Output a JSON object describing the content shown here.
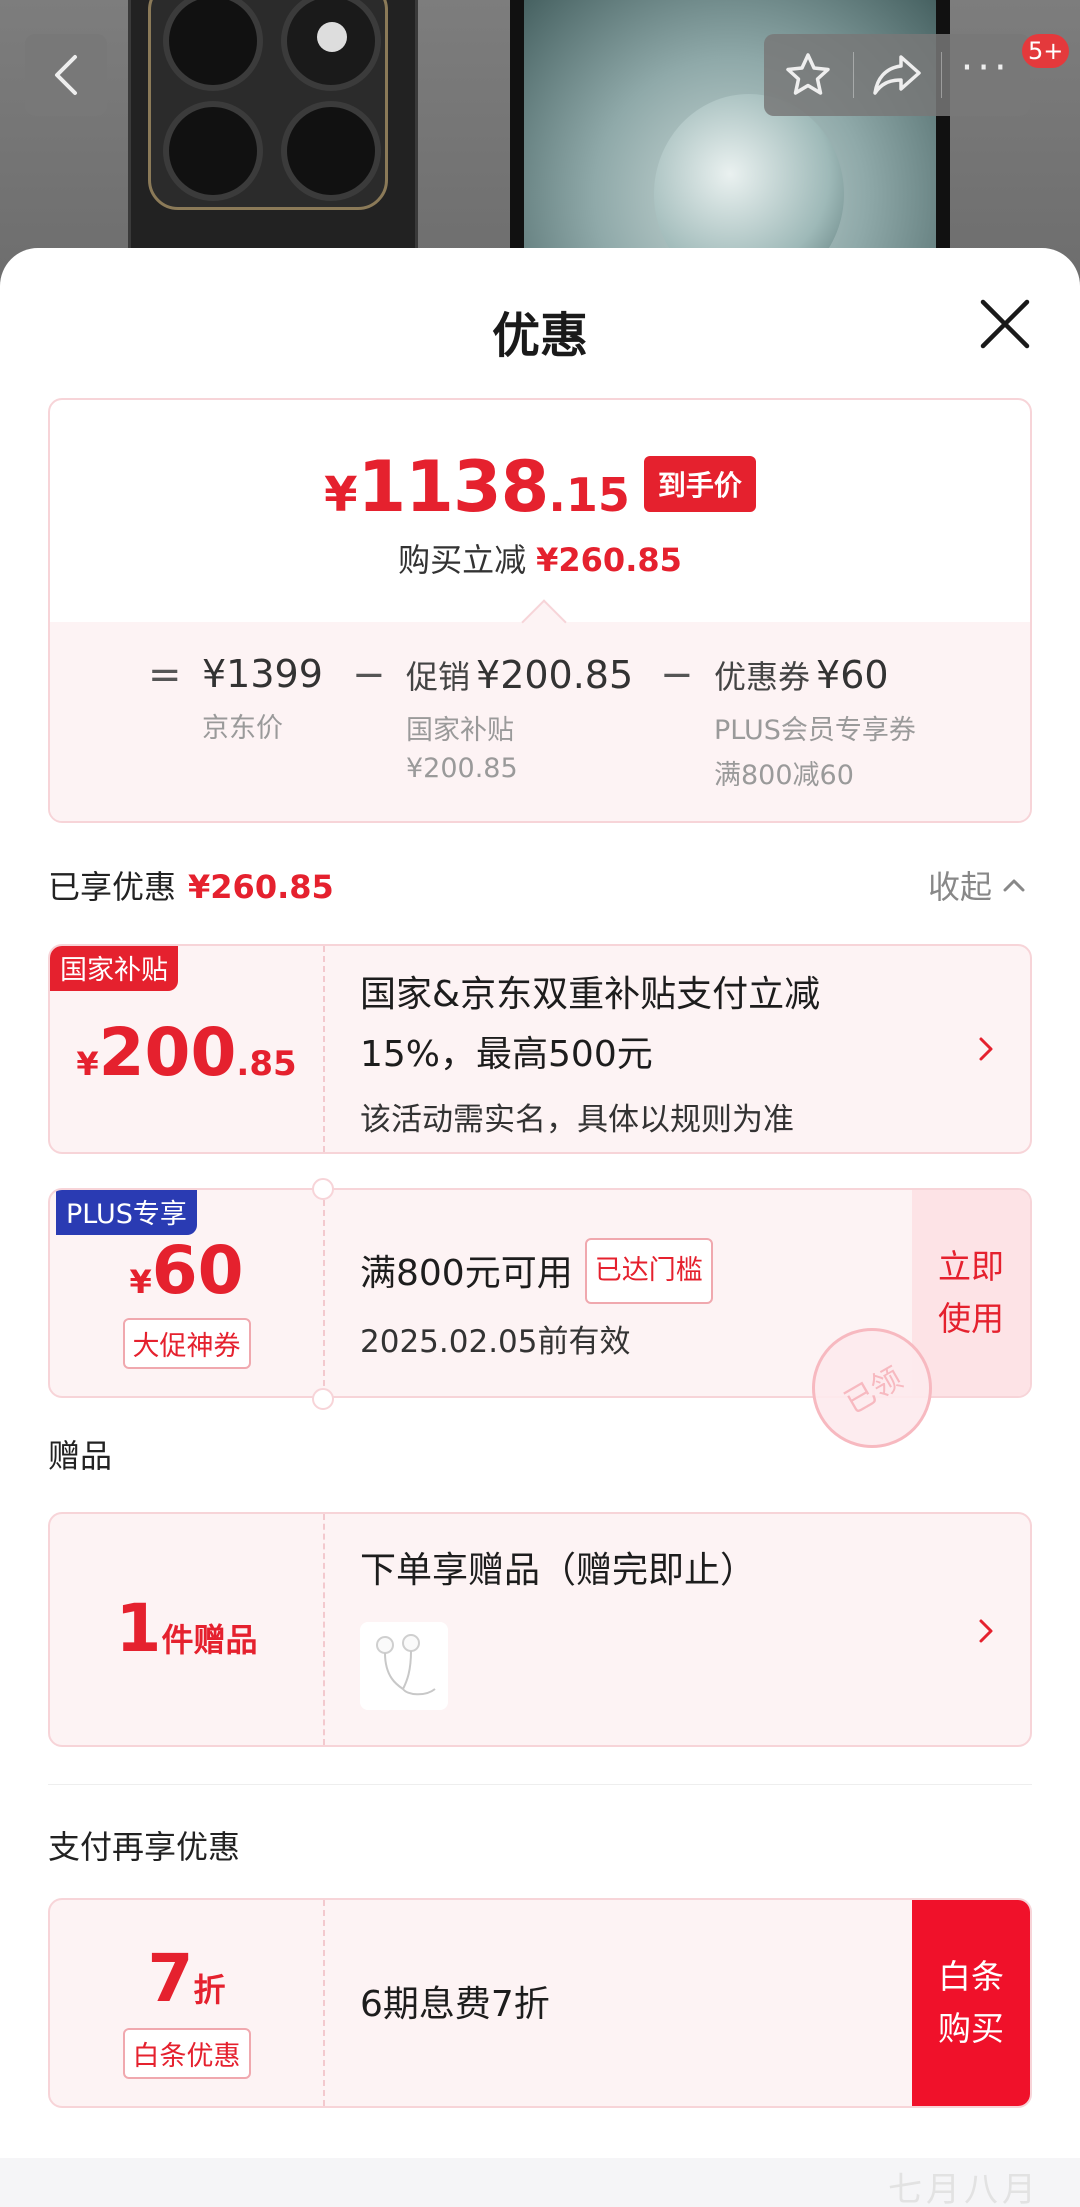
{
  "header": {
    "cart_badge": "5+"
  },
  "sheet": {
    "title": "优惠"
  },
  "summary": {
    "price_yen": "¥",
    "price_int": "1138",
    "price_dec": ".15",
    "price_tag": "到手价",
    "reduce_label": "购买立减",
    "reduce_amount": "¥260.85",
    "eq": "=",
    "minus": "−",
    "jd_price": "¥1399",
    "jd_label": "京东价",
    "promo_label": "促销",
    "promo_amount": "¥200.85",
    "promo_sub": "国家补贴",
    "promo_sub_amount": "¥200.85",
    "coupon_label": "优惠券",
    "coupon_amount": "¥60",
    "coupon_sub": "PLUS会员专享券",
    "coupon_sub2": "满800减60"
  },
  "enjoyed": {
    "label": "已享优惠",
    "amount": "¥260.85",
    "collapse": "收起"
  },
  "subsidy_card": {
    "tag": "国家补贴",
    "yen": "¥",
    "int": "200",
    "dec": ".85",
    "line1": "国家&京东双重补贴支付立减",
    "line2": "15%，最高500元",
    "sub": "该活动需实名，具体以规则为准"
  },
  "plus_card": {
    "tag": "PLUS专享",
    "yen": "¥",
    "int": "60",
    "badge": "大促神券",
    "condition": "满800元可用",
    "reached": "已达门槛",
    "expiry": "2025.02.05前有效",
    "use_line1": "立即",
    "use_line2": "使用",
    "stamp": "已领"
  },
  "gift_section": {
    "title": "赠品",
    "count": "1",
    "count_unit": "件赠品",
    "desc": "下单享赠品（赠完即止）"
  },
  "pay_section": {
    "title": "支付再享优惠",
    "discount": "7",
    "discount_unit": "折",
    "badge": "白条优惠",
    "desc": "6期息费7折",
    "btn_line1": "白条",
    "btn_line2": "购买"
  },
  "watermark": "七月八月",
  "colors": {
    "accent": "#e5212e",
    "card_bg": "#fdf3f4",
    "card_border": "#f7d4d8",
    "plus_blue": "#2a3bb3"
  }
}
